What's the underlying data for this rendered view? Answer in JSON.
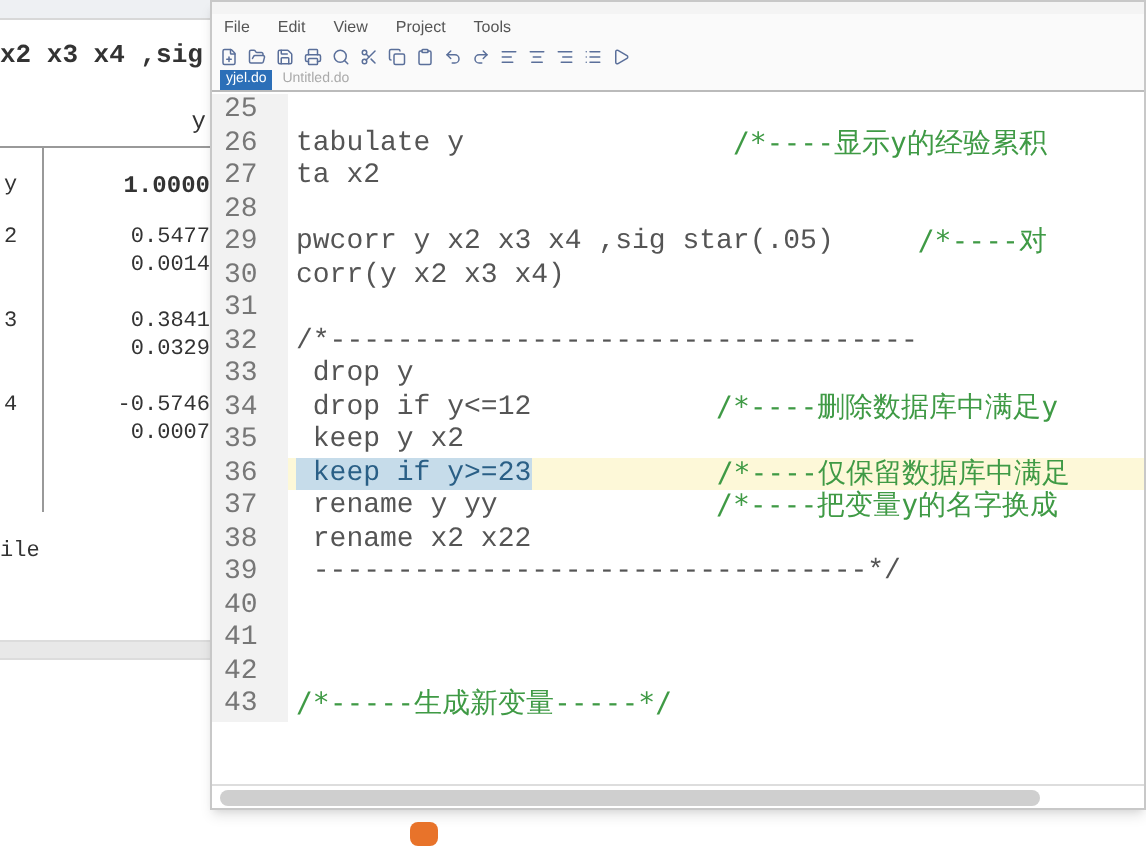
{
  "results": {
    "command": "x2 x3 x4 ,sig",
    "header": "y",
    "rows": [
      {
        "label": "y",
        "values": [
          "1.0000"
        ]
      },
      {
        "label": "2",
        "values": [
          "0.5477",
          "0.0014"
        ]
      },
      {
        "label": "3",
        "values": [
          "0.3841",
          "0.0329"
        ]
      },
      {
        "label": "4",
        "values": [
          "-0.5746",
          "0.0007"
        ]
      }
    ],
    "footer": "ile"
  },
  "editor": {
    "menu": [
      "File",
      "Edit",
      "View",
      "Project",
      "Tools"
    ],
    "tabs": [
      {
        "label": "yjel.do",
        "selected": true
      },
      {
        "label": "Untitled.do",
        "selected": false
      }
    ],
    "lines": [
      {
        "number": "25"
      },
      {
        "number": "26",
        "code": "tabulate y                ",
        "comment": "/*----显示y的经验累积"
      },
      {
        "number": "27",
        "code": "ta x2"
      },
      {
        "number": "28"
      },
      {
        "number": "29",
        "code": "pwcorr y x2 x3 x4 ,sig star(.05)     ",
        "comment": "/*----对"
      },
      {
        "number": "30",
        "code": "corr(y x2 x3 x4)"
      },
      {
        "number": "31"
      },
      {
        "number": "32",
        "code": "/*-----------------------------------"
      },
      {
        "number": "33",
        "code": " drop y"
      },
      {
        "number": "34",
        "code": " drop if y<=12           ",
        "comment": "/*----删除数据库中满足y"
      },
      {
        "number": "35",
        "code": " keep y x2"
      },
      {
        "number": "36",
        "code": " keep if y>=23",
        "current": true,
        "selected": true,
        "comment": "           /*----仅保留数据库中满足"
      },
      {
        "number": "37",
        "code": " rename y yy             ",
        "comment": "/*----把变量y的名字换成"
      },
      {
        "number": "38",
        "code": " rename x2 x22"
      },
      {
        "number": "39",
        "code": " ---------------------------------*/"
      },
      {
        "number": "40"
      },
      {
        "number": "41"
      },
      {
        "number": "42"
      },
      {
        "number": "43",
        "comment": "/*-----生成新变量-----*/"
      }
    ]
  }
}
